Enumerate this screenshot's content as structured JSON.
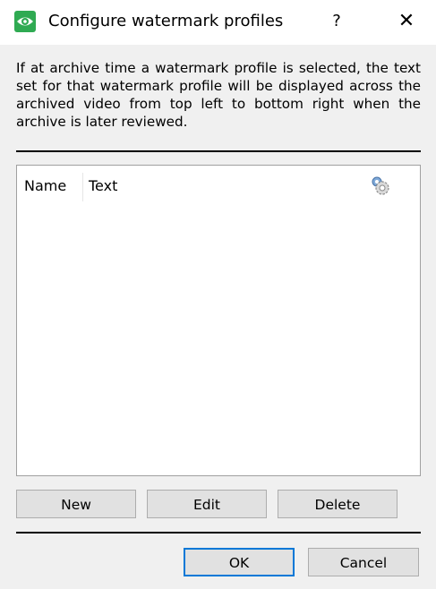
{
  "window": {
    "title": "Configure watermark profiles",
    "help_label": "?",
    "close_label": "✕",
    "app_icon": "eye-icon",
    "app_icon_color": "#2faa52"
  },
  "description": "If at archive time a watermark profile is selected, the text set for that watermark profile will be displayed across the archived video from top left to bottom right when the archive is later reviewed.",
  "table": {
    "columns": [
      "Name",
      "Text"
    ],
    "settings_icon": "gear-icon",
    "rows": []
  },
  "buttons": {
    "new": "New",
    "edit": "Edit",
    "delete": "Delete",
    "ok": "OK",
    "cancel": "Cancel"
  },
  "colors": {
    "ok_focus_border": "#0078d7"
  }
}
